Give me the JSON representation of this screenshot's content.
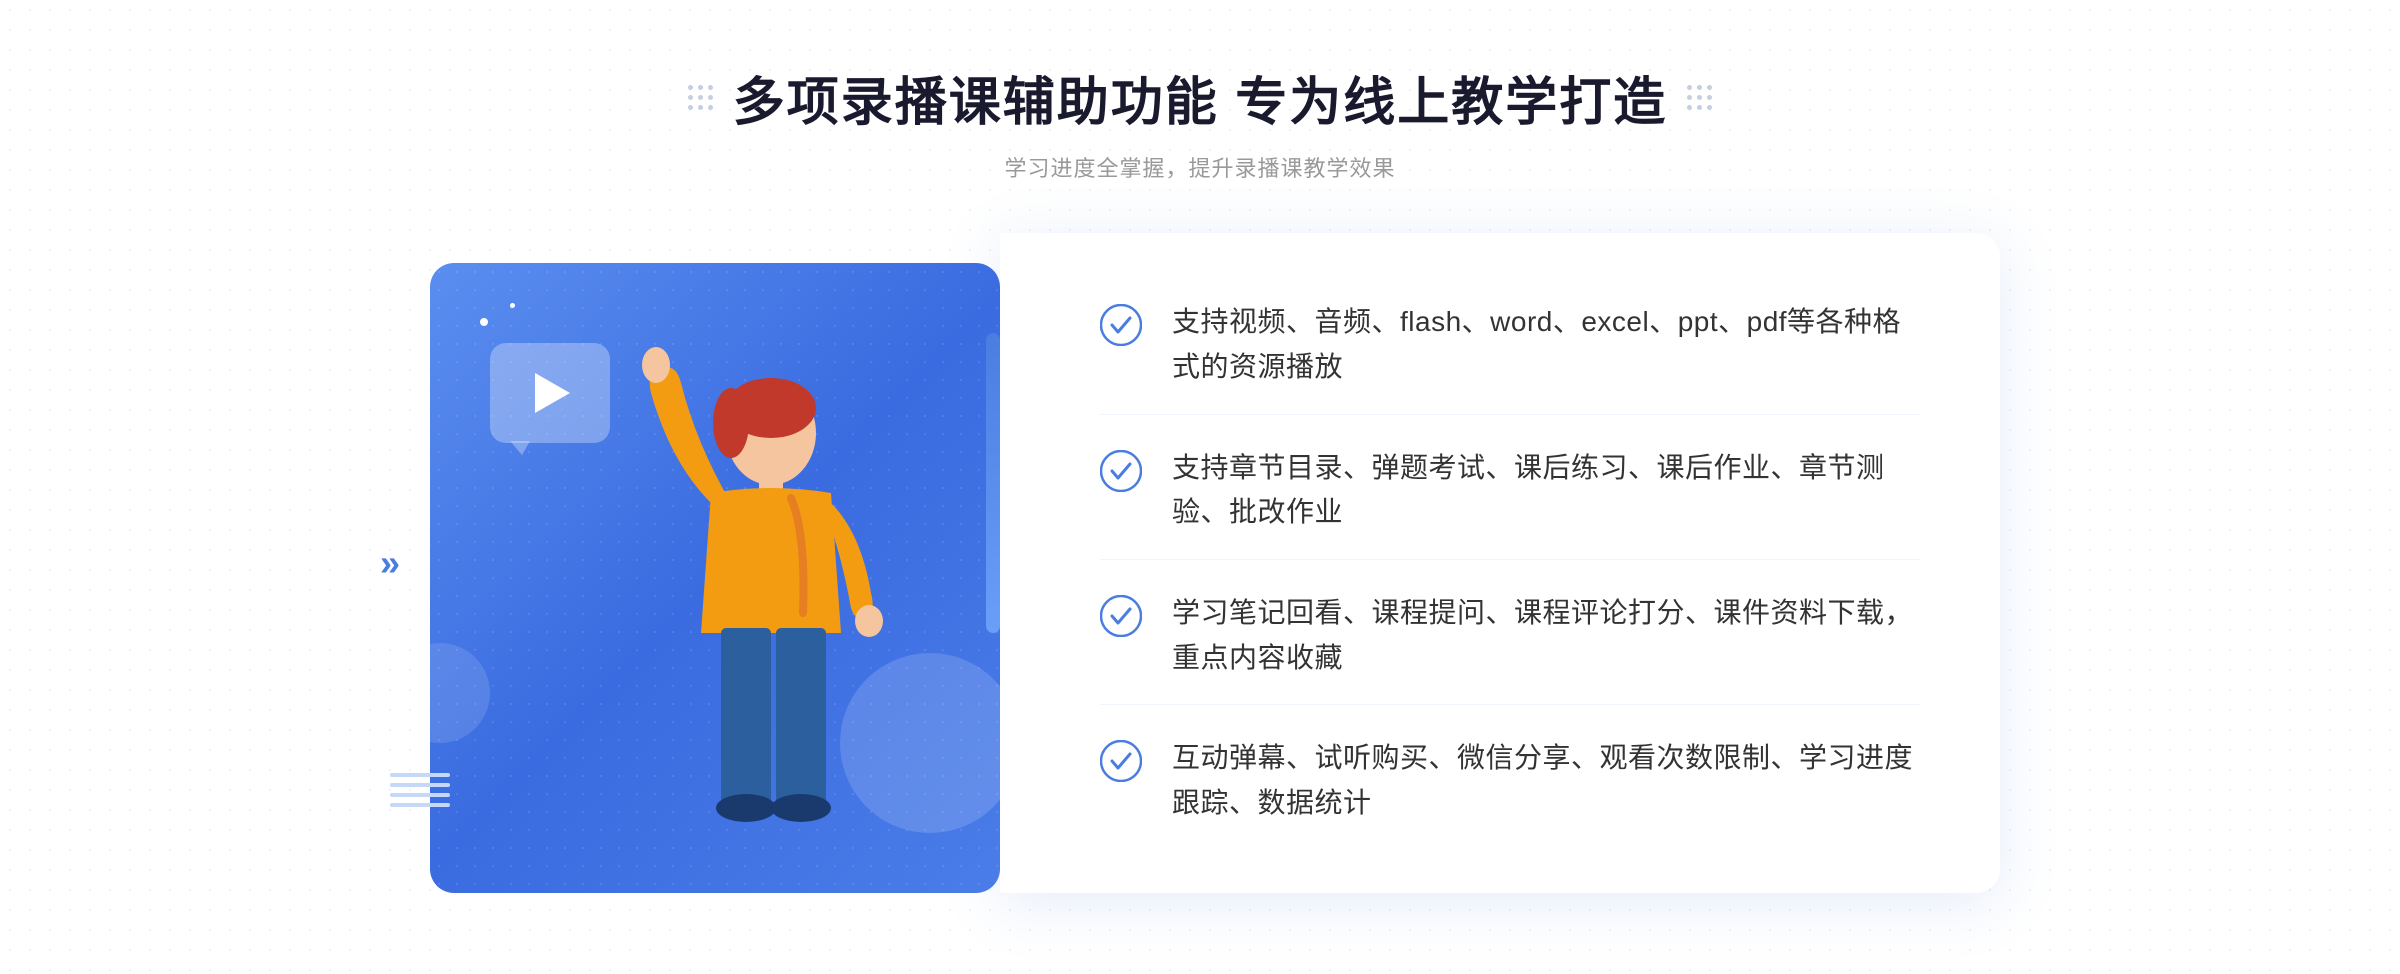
{
  "header": {
    "title": "多项录播课辅助功能 专为线上教学打造",
    "subtitle": "学习进度全掌握，提升录播课教学效果",
    "decorative_label": "decorative-dots"
  },
  "features": [
    {
      "id": 1,
      "text": "支持视频、音频、flash、word、excel、ppt、pdf等各种格式的资源播放"
    },
    {
      "id": 2,
      "text": "支持章节目录、弹题考试、课后练习、课后作业、章节测验、批改作业"
    },
    {
      "id": 3,
      "text": "学习笔记回看、课程提问、课程评论打分、课件资料下载，重点内容收藏"
    },
    {
      "id": 4,
      "text": "互动弹幕、试听购买、微信分享、观看次数限制、学习进度跟踪、数据统计"
    }
  ],
  "colors": {
    "primary_blue": "#4a7de0",
    "light_blue": "#6a9ef8",
    "card_bg": "#5b8ef0",
    "text_dark": "#1a1a2e",
    "text_gray": "#999"
  },
  "icons": {
    "check": "check-circle-icon",
    "play": "play-icon",
    "chevron": "chevron-right-icon"
  }
}
